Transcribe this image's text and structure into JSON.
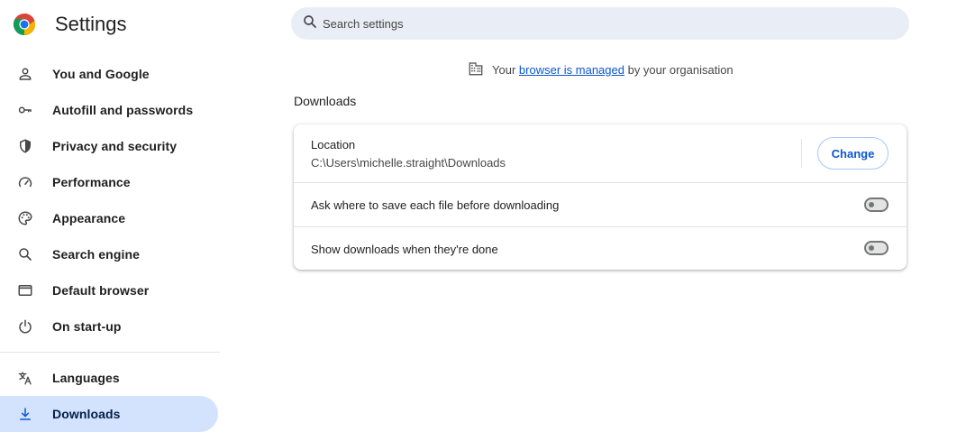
{
  "header": {
    "title": "Settings",
    "logo_icon": "chrome-logo-icon"
  },
  "search": {
    "placeholder": "Search settings",
    "value": ""
  },
  "sidebar": {
    "items": [
      {
        "label": "You and Google",
        "icon": "person-icon"
      },
      {
        "label": "Autofill and passwords",
        "icon": "key-icon"
      },
      {
        "label": "Privacy and security",
        "icon": "shield-icon"
      },
      {
        "label": "Performance",
        "icon": "speedometer-icon"
      },
      {
        "label": "Appearance",
        "icon": "palette-icon"
      },
      {
        "label": "Search engine",
        "icon": "search-icon"
      },
      {
        "label": "Default browser",
        "icon": "browser-window-icon"
      },
      {
        "label": "On start-up",
        "icon": "power-icon"
      }
    ],
    "items_after_divider": [
      {
        "label": "Languages",
        "icon": "translate-icon"
      },
      {
        "label": "Downloads",
        "icon": "download-icon",
        "active": true
      }
    ]
  },
  "managed_notice": {
    "prefix": "Your",
    "link": "browser is managed",
    "suffix": "by your organisation",
    "icon": "building-icon"
  },
  "downloads": {
    "section_title": "Downloads",
    "location_label": "Location",
    "location_value": "C:\\Users\\michelle.straight\\Downloads",
    "change_button": "Change",
    "ask_label": "Ask where to save each file before downloading",
    "ask_enabled": false,
    "show_label": "Show downloads when they're done",
    "show_enabled": false
  },
  "colors": {
    "accent": "#0b57d0",
    "active_nav_bg": "#d3e3fd",
    "search_bg": "#e9eef6"
  }
}
